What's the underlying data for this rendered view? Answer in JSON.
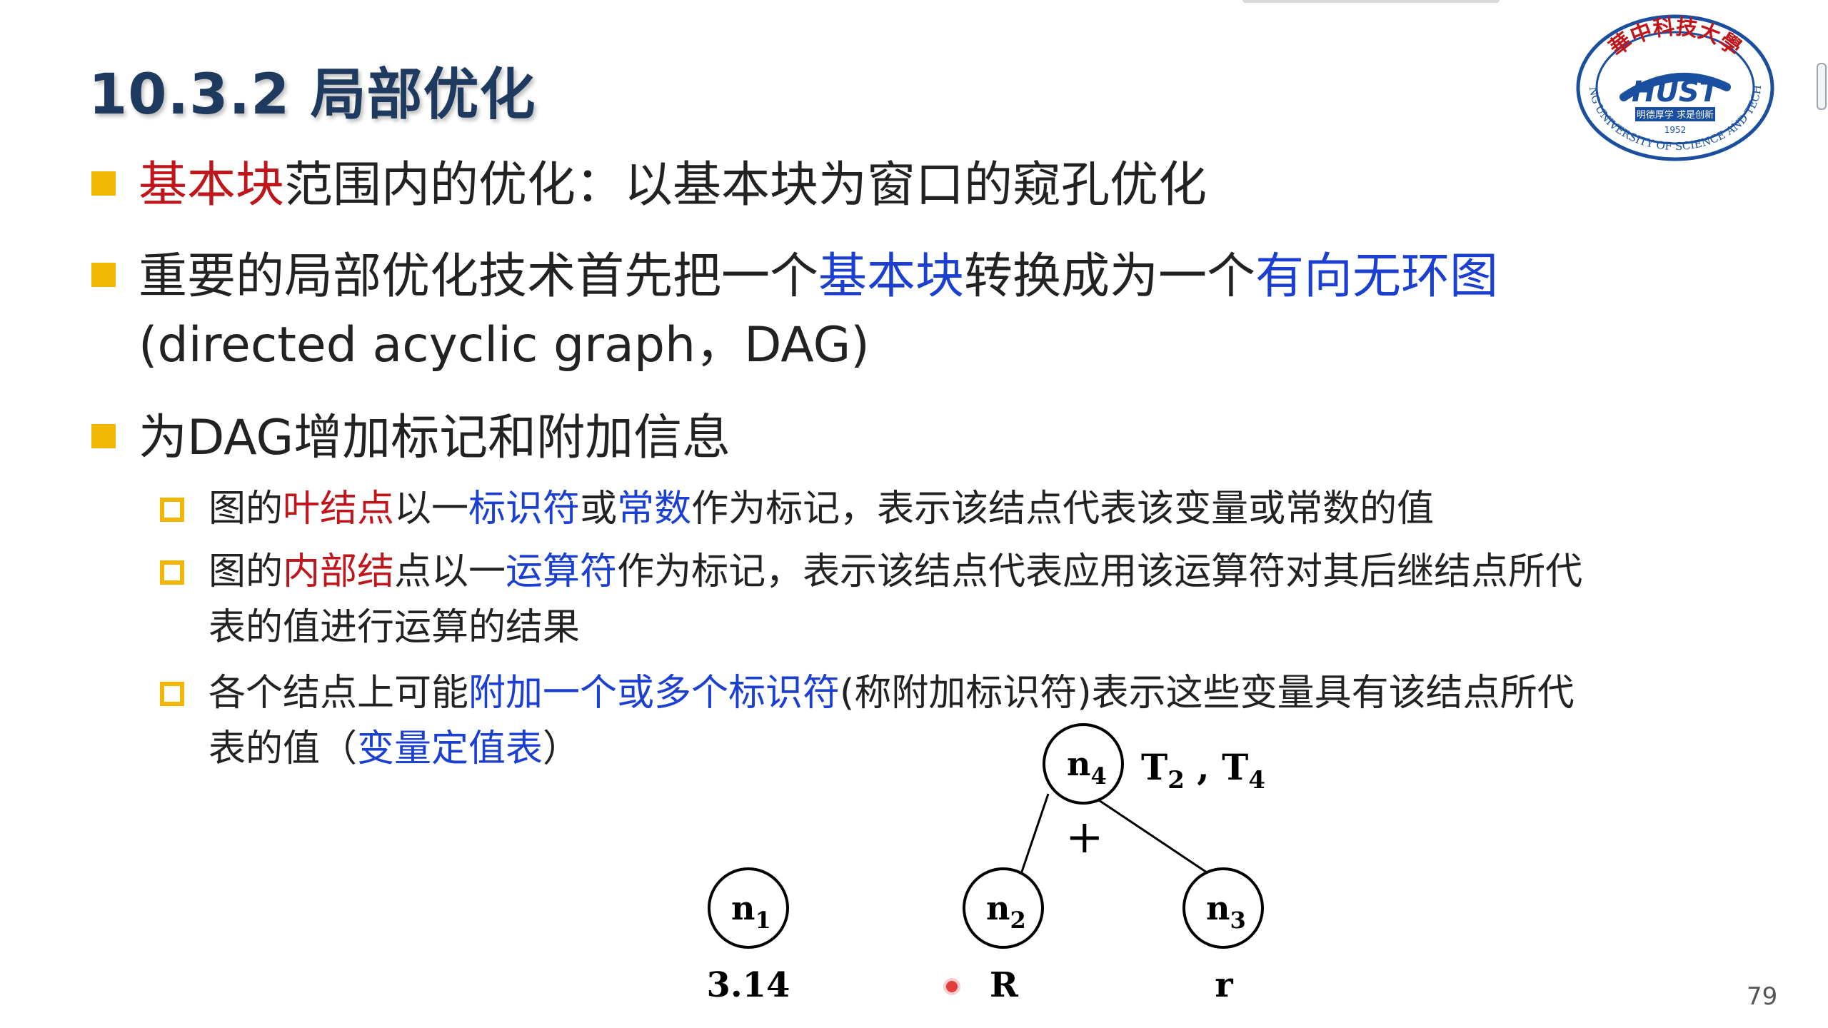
{
  "title": "10.3.2 局部优化",
  "logo": {
    "top_text": "華中科技大學",
    "ring_text": "HUAZHONG UNIVERSITY OF SCIENCE AND TECHNOLOGY",
    "center_text": "HUST",
    "motto": "明德厚学 求是创新",
    "year": "1952"
  },
  "bullets": [
    {
      "parts": [
        {
          "text": "基本块",
          "style": "red"
        },
        {
          "text": "范围内的优化：以基本块为窗口的窥孔优化",
          "style": ""
        }
      ]
    },
    {
      "parts": [
        {
          "text": "重要的局部优化技术首先把一个",
          "style": ""
        },
        {
          "text": "基本块",
          "style": "blue"
        },
        {
          "text": "转换成为一个",
          "style": ""
        },
        {
          "text": "有向无环图",
          "style": "blue"
        }
      ],
      "line2": "(directed acyclic graph，DAG)"
    },
    {
      "parts": [
        {
          "text": "为DAG增加标记和附加信息",
          "style": ""
        }
      ]
    }
  ],
  "subbullets": [
    {
      "parts": [
        {
          "text": "图的",
          "style": ""
        },
        {
          "text": "叶结点",
          "style": "red"
        },
        {
          "text": "以一",
          "style": ""
        },
        {
          "text": "标识符",
          "style": "blue"
        },
        {
          "text": "或",
          "style": ""
        },
        {
          "text": "常数",
          "style": "blue"
        },
        {
          "text": "作为标记，表示该结点代表该变量或常数的值",
          "style": ""
        }
      ]
    },
    {
      "parts": [
        {
          "text": "图的",
          "style": ""
        },
        {
          "text": "内部结",
          "style": "red"
        },
        {
          "text": "点以一",
          "style": ""
        },
        {
          "text": "运算符",
          "style": "blue"
        },
        {
          "text": "作为标记，表示该结点代表应用该运算符对其后继结点所代",
          "style": ""
        }
      ],
      "line2": "表的值进行运算的结果"
    },
    {
      "parts": [
        {
          "text": "各个结点上可能",
          "style": ""
        },
        {
          "text": "附加一个或多个标识符",
          "style": "blue"
        },
        {
          "text": "(称附加标识符)表示这些变量具有该结点所代",
          "style": ""
        }
      ],
      "line2_parts": [
        {
          "text": "表的值（",
          "style": ""
        },
        {
          "text": "变量定值表",
          "style": "blue"
        },
        {
          "text": "）",
          "style": ""
        }
      ]
    }
  ],
  "dag": {
    "n4": {
      "label": "n",
      "sub": "4",
      "attached": [
        "T",
        "2",
        " , T",
        "4"
      ],
      "op": "+"
    },
    "n1": {
      "label": "n",
      "sub": "1",
      "leaf": "3.14"
    },
    "n2": {
      "label": "n",
      "sub": "2",
      "leaf": "R"
    },
    "n3": {
      "label": "n",
      "sub": "3",
      "leaf": "r"
    }
  },
  "page_number": "79",
  "colors": {
    "title": "#1f3a5f",
    "red": "#c0161b",
    "blue": "#1b3fd1",
    "bullet": "#f2b705",
    "logo": "#1a4fa0",
    "logo_red": "#c0161b"
  }
}
